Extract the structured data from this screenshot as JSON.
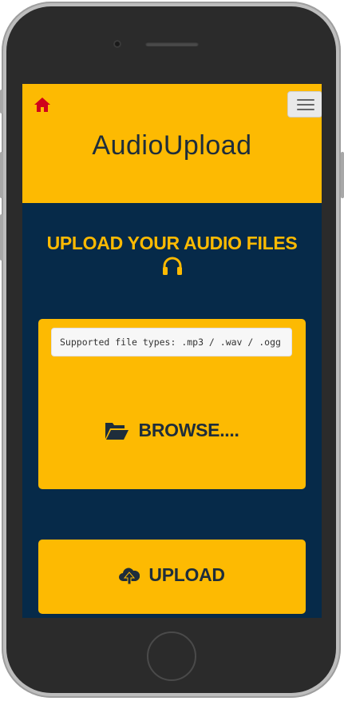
{
  "header": {
    "app_title": "AudioUpload"
  },
  "main": {
    "heading": "UPLOAD YOUR AUDIO FILES",
    "supported_types": "Supported file types: .mp3 / .wav / .ogg",
    "browse_label": "BROWSE....",
    "upload_label": "UPLOAD"
  },
  "colors": {
    "accent": "#fdba02",
    "background": "#062a49",
    "home_icon": "#d0021b",
    "text_dark": "#1e2d3b"
  },
  "icons": [
    "home-icon",
    "menu-icon",
    "headphones-icon",
    "folder-open-icon",
    "cloud-upload-icon"
  ]
}
